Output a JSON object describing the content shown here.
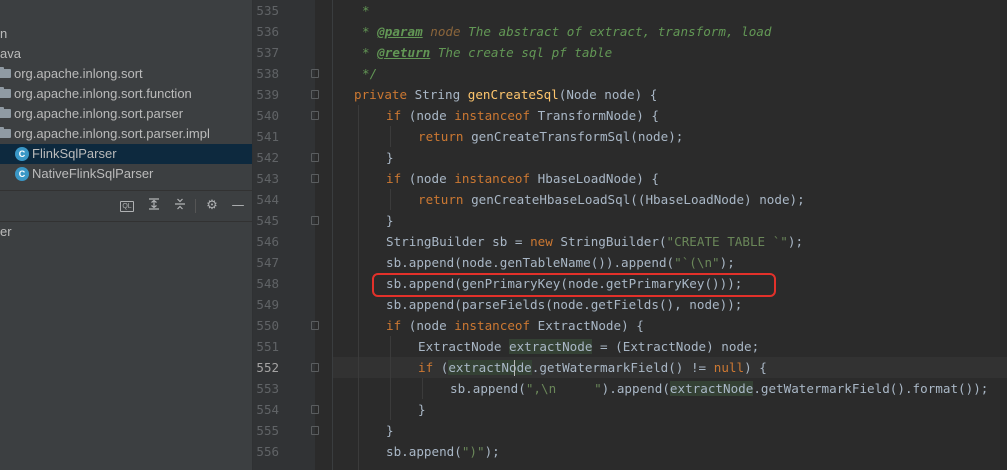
{
  "project_tree": {
    "items": [
      {
        "label": "n",
        "icon": "none",
        "indent": 0,
        "selected": false
      },
      {
        "label": "ava",
        "icon": "none",
        "indent": 0,
        "selected": false
      },
      {
        "label": "org.apache.inlong.sort",
        "icon": "package-folder-icon",
        "selected": false
      },
      {
        "label": "org.apache.inlong.sort.function",
        "icon": "package-folder-icon",
        "selected": false
      },
      {
        "label": "org.apache.inlong.sort.parser",
        "icon": "package-folder-icon",
        "selected": false
      },
      {
        "label": "org.apache.inlong.sort.parser.impl",
        "icon": "package-folder-icon",
        "selected": false
      },
      {
        "label": "FlinkSqlParser",
        "icon": "class-icon",
        "selected": true
      },
      {
        "label": "NativeFlinkSqlParser",
        "icon": "class-icon",
        "selected": false
      }
    ],
    "class_icon_letter": "C"
  },
  "structure_toolbar": {
    "ql_label": "QL",
    "icons": [
      "ql-icon",
      "expand-all-icon",
      "collapse-all-icon",
      "settings-gear-icon",
      "minimize-icon"
    ]
  },
  "structure_panel": {
    "title_fragment": "er"
  },
  "editor": {
    "current_line": "552",
    "highlight_color": "#e2312a",
    "lines": [
      {
        "n": "535"
      },
      {
        "n": "536"
      },
      {
        "n": "537"
      },
      {
        "n": "538"
      },
      {
        "n": "539"
      },
      {
        "n": "540"
      },
      {
        "n": "541"
      },
      {
        "n": "542"
      },
      {
        "n": "543"
      },
      {
        "n": "544"
      },
      {
        "n": "545"
      },
      {
        "n": "546"
      },
      {
        "n": "547"
      },
      {
        "n": "548"
      },
      {
        "n": "549"
      },
      {
        "n": "550"
      },
      {
        "n": "551"
      },
      {
        "n": "552"
      },
      {
        "n": "553"
      },
      {
        "n": "554"
      },
      {
        "n": "555"
      },
      {
        "n": "556"
      }
    ],
    "code": {
      "l535_star": "*",
      "l536_star": "* ",
      "l536_tag": "@param",
      "l536_param": " node",
      "l536_text": " The abstract of extract, transform, load",
      "l537_star": "* ",
      "l537_tag": "@return",
      "l537_text": " The create sql pf table",
      "l538": "*/",
      "l539_kw": "private",
      "l539_type": " String ",
      "l539_fn": "genCreateSql",
      "l539_rest": "(Node node) {",
      "l540_kw1": "if",
      "l540_a": " (node ",
      "l540_kw2": "instanceof",
      "l540_b": " TransformNode) {",
      "l541_kw": "return",
      "l541_rest": " genCreateTransformSql(node);",
      "l542": "}",
      "l543_kw1": "if",
      "l543_a": " (node ",
      "l543_kw2": "instanceof",
      "l543_b": " HbaseLoadNode) {",
      "l544_kw": "return",
      "l544_rest": " genCreateHbaseLoadSql((HbaseLoadNode) node);",
      "l545": "}",
      "l546_a": "StringBuilder sb = ",
      "l546_kw": "new",
      "l546_b": " StringBuilder(",
      "l546_str": "\"CREATE TABLE `\"",
      "l546_c": ");",
      "l547_a": "sb.append(node.genTableName()).append(",
      "l547_str": "\"`(\\n\"",
      "l547_c": ");",
      "l548": "sb.append(genPrimaryKey(node.getPrimaryKey()));",
      "l549": "sb.append(parseFields(node.getFields(), node));",
      "l550_kw1": "if",
      "l550_a": " (node ",
      "l550_kw2": "instanceof",
      "l550_b": " ExtractNode) {",
      "l551_a": "ExtractNode ",
      "l551_hl": "extractNode",
      "l551_b": " = (ExtractNode) node;",
      "l552_kw": "if",
      "l552_a": " (",
      "l552_hl": "extractNode",
      "l552_b": ".getWatermarkField() != ",
      "l552_kw2": "null",
      "l552_c": ") {",
      "l553_a": "sb.append(",
      "l553_str": "\",\\n     \"",
      "l553_b": ").append(",
      "l553_hl": "extractNode",
      "l553_c": ".getWatermarkField().format());",
      "l554": "}",
      "l555": "}",
      "l556_a": "sb.append(",
      "l556_str": "\")\"",
      "l556_b": ");"
    }
  }
}
